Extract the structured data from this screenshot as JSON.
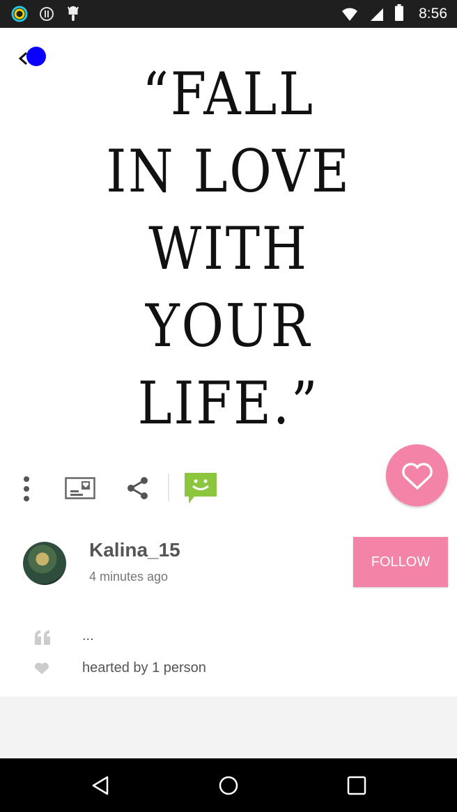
{
  "status_bar": {
    "time": "8:56",
    "icons": [
      "ring-indicator-icon",
      "alert-circle-icon",
      "android-icon"
    ]
  },
  "quote_image": {
    "text": "“FALL\nIN LOVE\nWITH\nYOUR\nLIFE.”"
  },
  "actions": {
    "icons": [
      "more-vert-icon",
      "card-icon",
      "share-icon",
      "chat-smile-icon",
      "heart-icon"
    ]
  },
  "post": {
    "username": "Kalina_15",
    "time_ago": "4 minutes ago",
    "follow_label": "FOLLOW",
    "caption": "...",
    "hearted_text": "hearted by 1 person"
  },
  "colors": {
    "accent_pink": "#f483a8",
    "chat_green": "#8cc63f"
  },
  "nav_bar": {
    "icons": [
      "back-triangle-icon",
      "home-circle-icon",
      "recents-square-icon"
    ]
  }
}
